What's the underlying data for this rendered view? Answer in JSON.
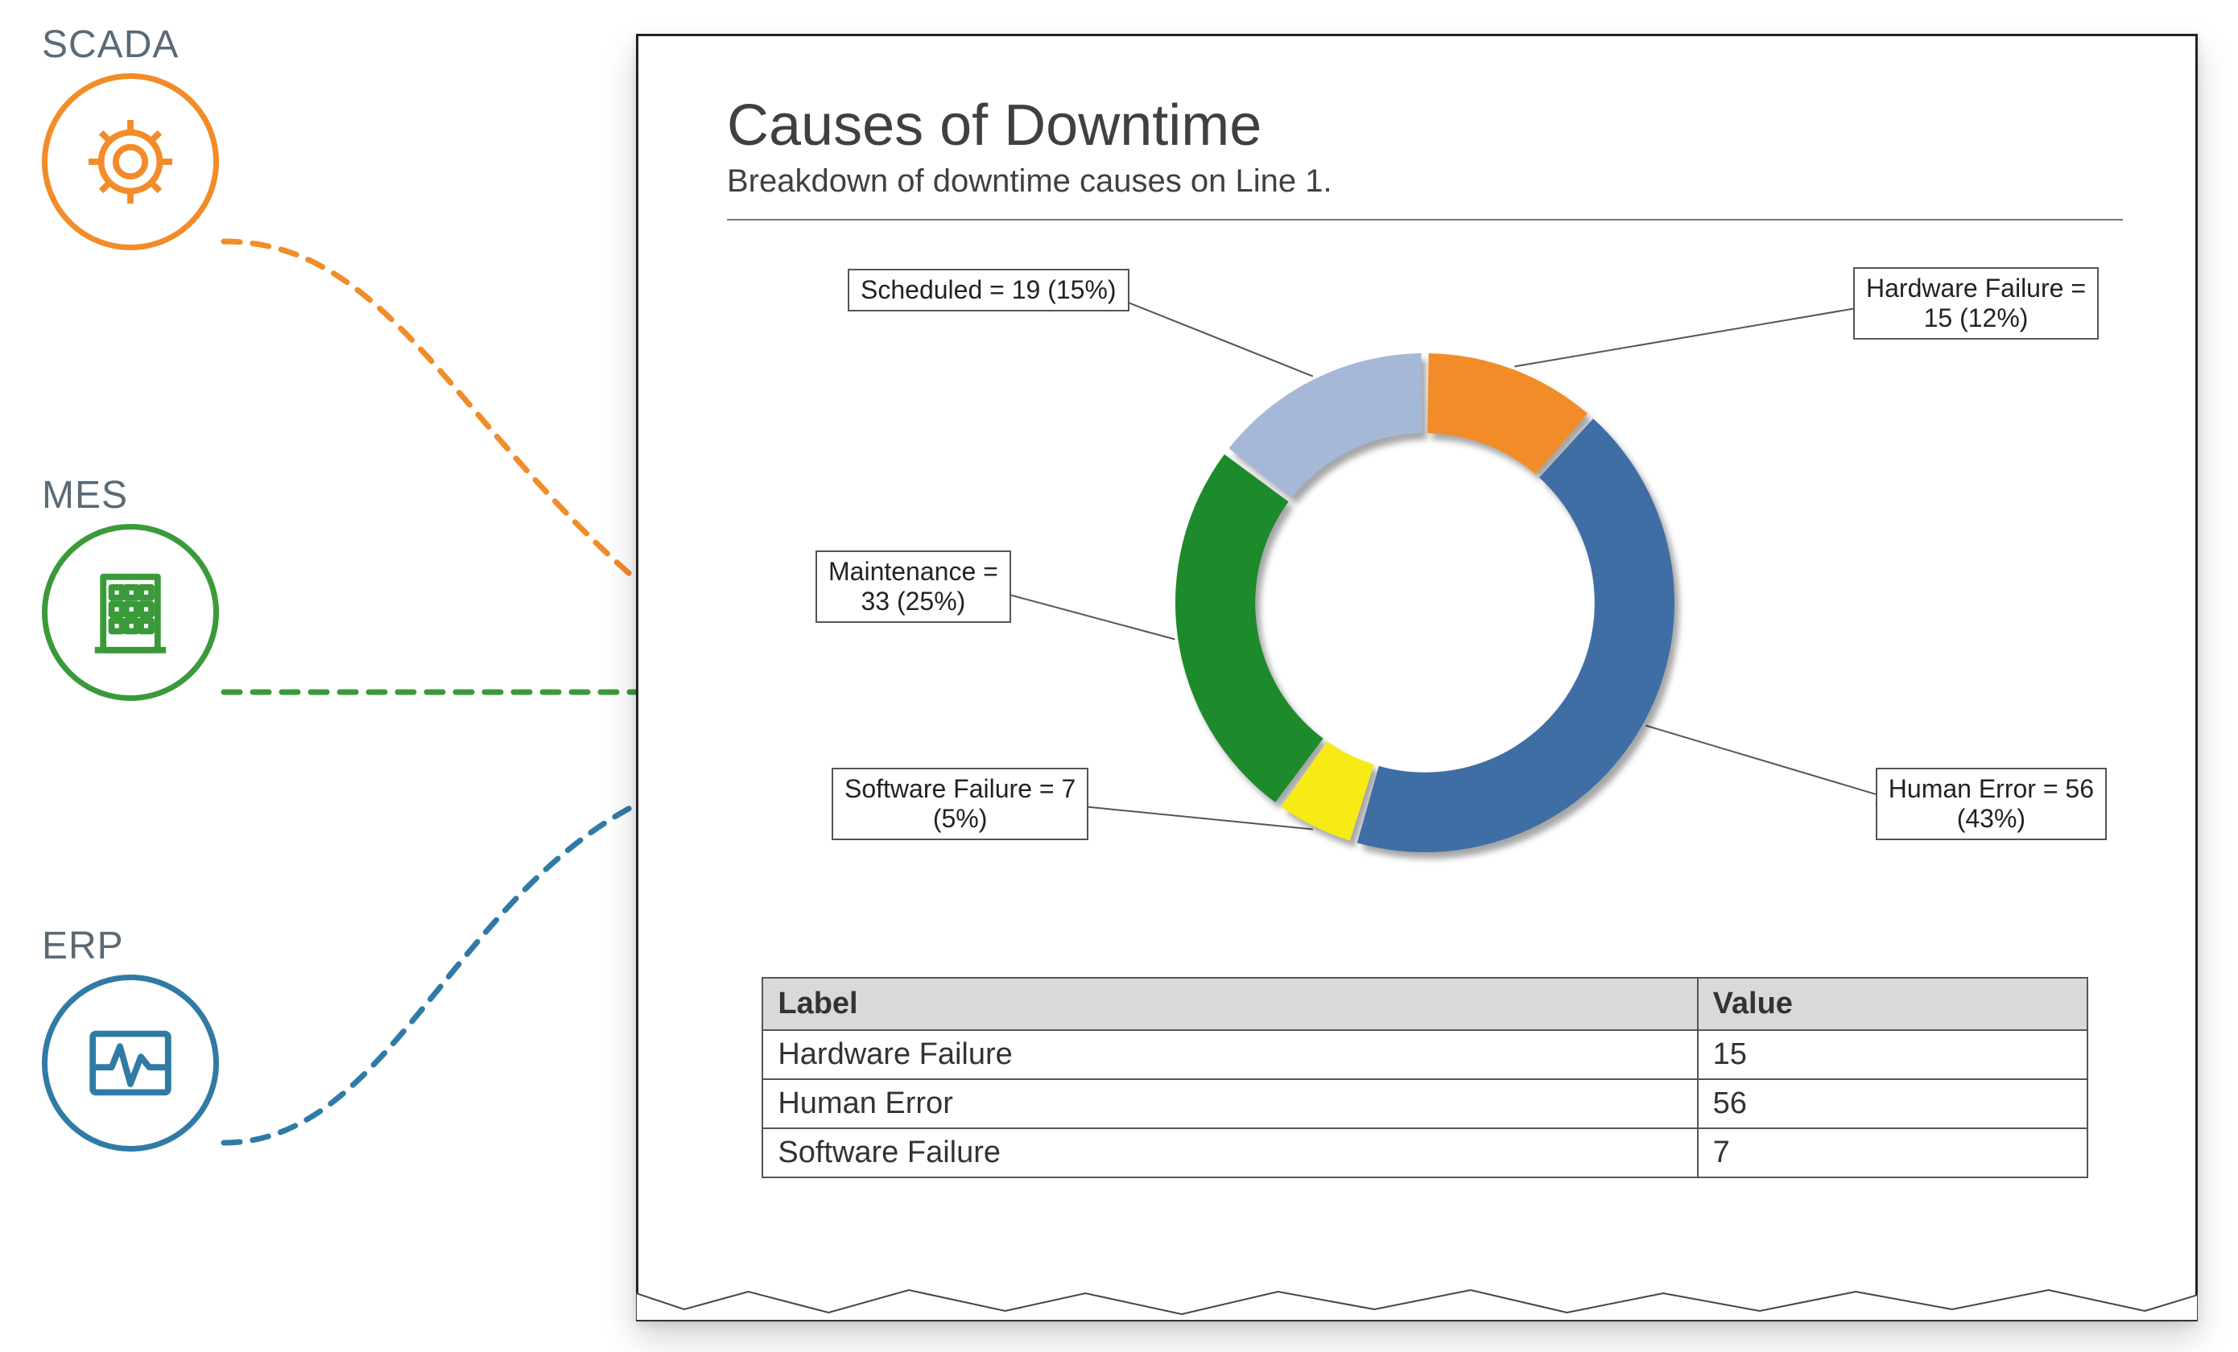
{
  "sources": {
    "scada": {
      "label": "SCADA",
      "color": "#f28c28"
    },
    "mes": {
      "label": "MES",
      "color": "#3a9a3a"
    },
    "erp": {
      "label": "ERP",
      "color": "#2f7ba6"
    }
  },
  "report": {
    "title": "Causes of Downtime",
    "subtitle": "Breakdown of downtime causes on Line 1."
  },
  "chart_data": {
    "type": "pie",
    "title": "Causes of Downtime",
    "subtitle": "Breakdown of downtime causes on Line 1.",
    "categories": [
      "Hardware Failure",
      "Human Error",
      "Software Failure",
      "Maintenance",
      "Scheduled"
    ],
    "values": [
      15,
      56,
      7,
      33,
      19
    ],
    "percentages": [
      12,
      43,
      5,
      25,
      15
    ],
    "colors": [
      "#f28c28",
      "#3f6ea5",
      "#f6eb14",
      "#1d8a2b",
      "#a6b8d8"
    ],
    "donut_inner_ratio": 0.68,
    "callout_labels": [
      "Hardware Failure =\n15 (12%)",
      "Human Error = 56\n(43%)",
      "Software Failure = 7\n(5%)",
      "Maintenance =\n33 (25%)",
      "Scheduled = 19 (15%)"
    ]
  },
  "table": {
    "headers": [
      "Label",
      "Value"
    ],
    "rows": [
      [
        "Hardware Failure",
        "15"
      ],
      [
        "Human Error",
        "56"
      ],
      [
        "Software Failure",
        "7"
      ]
    ]
  }
}
